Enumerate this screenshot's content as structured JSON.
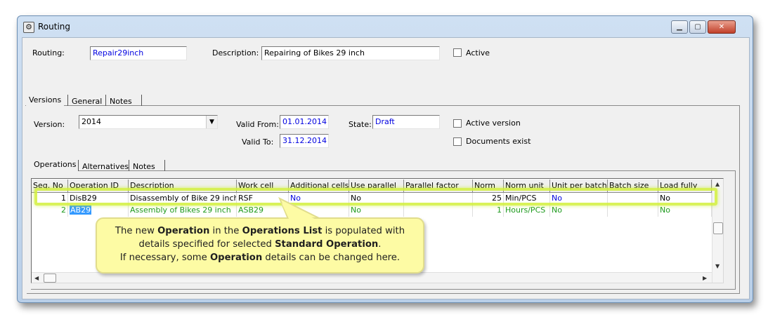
{
  "window": {
    "title": "Routing"
  },
  "header": {
    "routing_label": "Routing:",
    "routing_value": "Repair29inch",
    "description_label": "Description:",
    "description_value": "Repairing of Bikes 29 inch",
    "active_label": "Active"
  },
  "main_tabs": [
    "Versions",
    "General",
    "Notes"
  ],
  "version": {
    "version_label": "Version:",
    "version_value": "2014",
    "valid_from_label": "Valid From:",
    "valid_from_value": "01.01.2014",
    "valid_to_label": "Valid To:",
    "valid_to_value": "31.12.2014",
    "state_label": "State:",
    "state_value": "Draft",
    "active_version_label": "Active version",
    "documents_exist_label": "Documents exist"
  },
  "sub_tabs": [
    "Operations",
    "Alternatives",
    "Notes"
  ],
  "grid": {
    "columns": [
      "Seq. No",
      "Operation ID",
      "Description",
      "Work cell",
      "Additional cells",
      "Use parallel",
      "Parallel factor",
      "Norm",
      "Norm unit",
      "Unit per batch",
      "Batch size",
      "Load fully"
    ],
    "rows": [
      [
        "1",
        "DisB29",
        "Disassembly of Bike 29 inch",
        "RSF",
        "No",
        "No",
        "",
        "25",
        "Min/PCS",
        "No",
        "",
        "No"
      ],
      [
        "2",
        "AB29",
        "Assembly of Bikes 29 inch",
        "ASB29",
        "No",
        "No",
        "",
        "1",
        "Hours/PCS",
        "No",
        "",
        "No"
      ]
    ]
  },
  "callout": {
    "l1_a": "The new ",
    "l1_b": "Operation",
    "l1_c": " in the ",
    "l1_d": "Operations List",
    "l1_e": " is populated with",
    "l2_a": "details specified for selected ",
    "l2_b": "Standard Operation",
    "l2_c": ".",
    "l3_a": "If necessary, some ",
    "l3_b": "Operation",
    "l3_c": " details can be changed here."
  },
  "colors": {
    "blue_text": "#0000e0",
    "green_text": "#1e9a1e",
    "highlight": "#d2f03c",
    "callout_bg": "#fdfba4",
    "selection": "#3399ff"
  }
}
